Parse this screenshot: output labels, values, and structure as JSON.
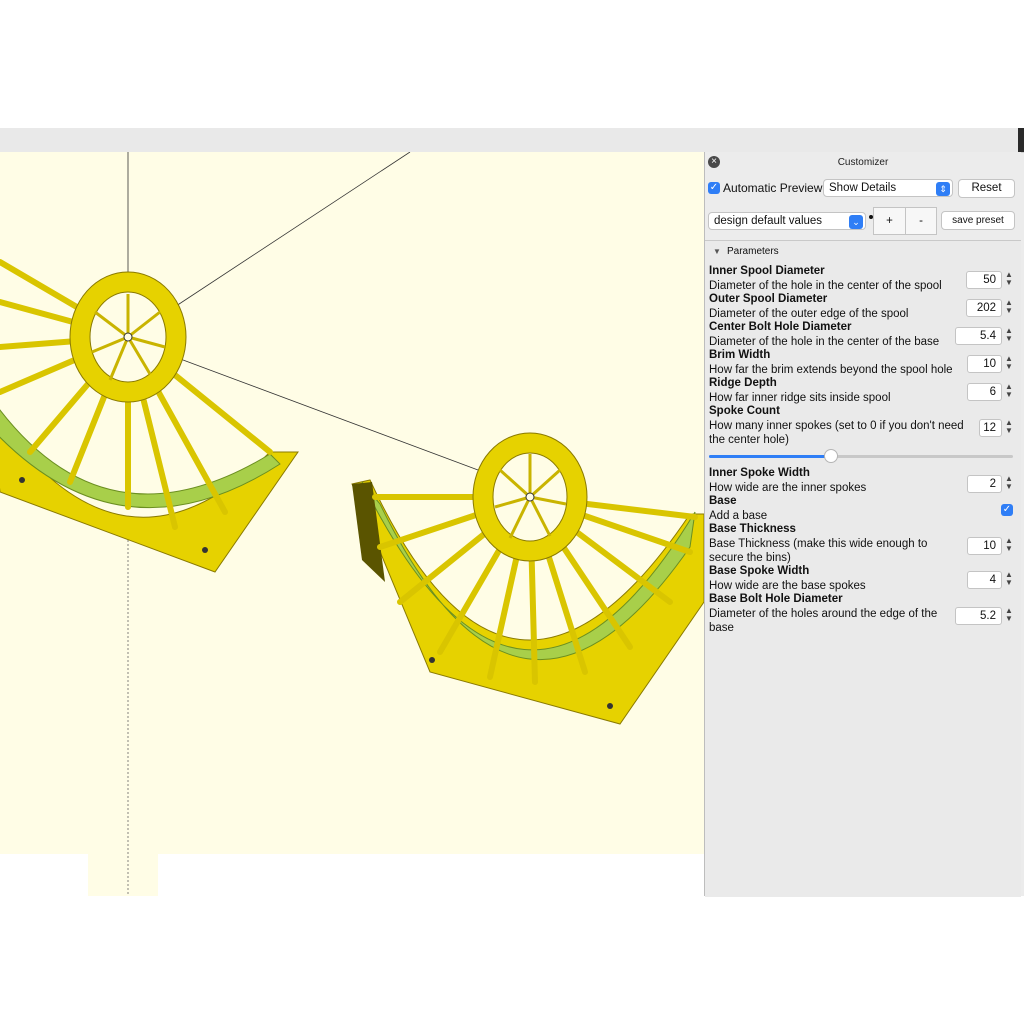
{
  "panel": {
    "title": "Customizer",
    "auto_preview_label": "Automatic Preview",
    "details_select": "Show Details",
    "reset_label": "Reset",
    "preset_select": "design default values",
    "plus_label": "+",
    "minus_label": "-",
    "save_preset_label": "save preset",
    "section_label": "Parameters",
    "spoke_slider_value": 12
  },
  "params": [
    {
      "title": "Inner Spool Diameter",
      "desc": [
        "Diameter of the hole in the center of the spool"
      ],
      "value": "50"
    },
    {
      "title": "Outer Spool Diameter",
      "desc": [
        "Diameter of the outer edge of the spool"
      ],
      "value": "202"
    },
    {
      "title": "Center Bolt Hole Diameter",
      "desc": [
        "Diameter of the hole in the center of the base"
      ],
      "value": "5.4"
    },
    {
      "title": "Brim Width",
      "desc": [
        "How far the brim extends beyond the spool hole"
      ],
      "value": "10"
    },
    {
      "title": "Ridge Depth",
      "desc": [
        "How far inner ridge sits inside spool"
      ],
      "value": "6"
    },
    {
      "title": "Spoke Count",
      "desc": [
        "How many inner spokes (set to 0 if you don't need",
        "the center hole)"
      ],
      "value": "12"
    },
    {
      "title": "Inner Spoke Width",
      "desc": [
        "How wide are the inner spokes"
      ],
      "value": "2"
    },
    {
      "title": "Base",
      "desc": [
        "Add a base"
      ],
      "value": "checked"
    },
    {
      "title": "Base Thickness",
      "desc": [
        "Base Thickness (make this wide enough to",
        "secure the bins)"
      ],
      "value": "10"
    },
    {
      "title": "Base Spoke Width",
      "desc": [
        "How wide are the base spokes"
      ],
      "value": "4"
    },
    {
      "title": "Base Bolt Hole Diameter",
      "desc": [
        "Diameter of the holes around the edge of the",
        "base"
      ],
      "value": "5.2"
    }
  ],
  "colors": {
    "viewport_bg": "#fffde6",
    "model_yellow": "#e6d200",
    "model_green": "#a8cf4a",
    "accent": "#2f7ef6"
  }
}
